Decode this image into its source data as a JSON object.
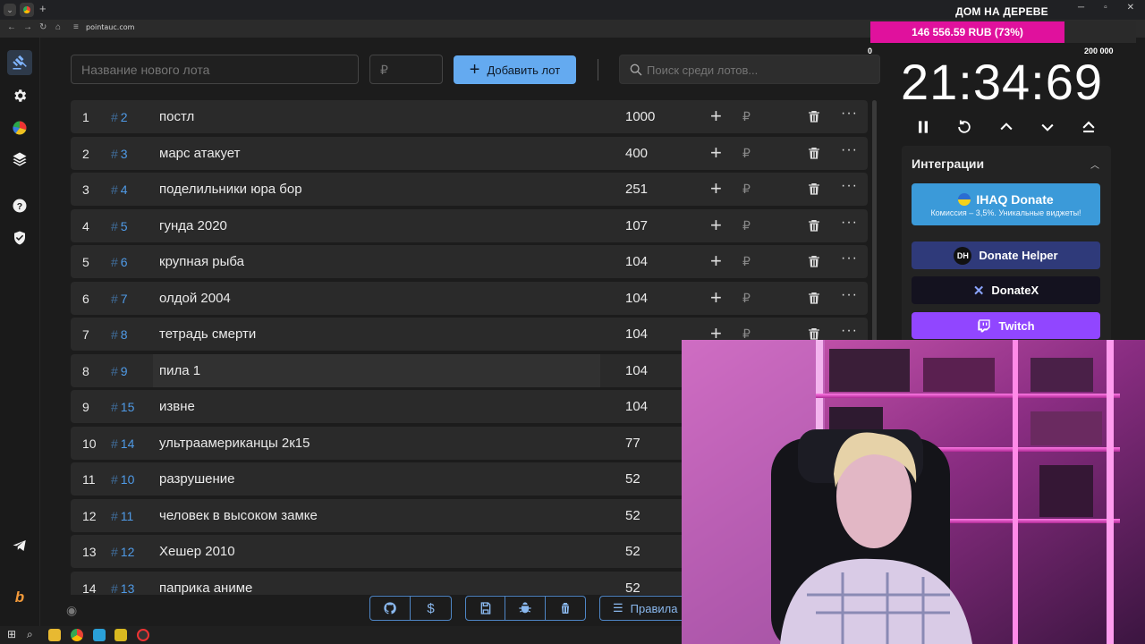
{
  "browser": {
    "url": "pointauc.com"
  },
  "stream": {
    "title": "ДОМ НА ДЕРЕВЕ",
    "goal_text": "146 556.59 RUB (73%)",
    "goal_progress": 0.73,
    "goal_min": "0",
    "goal_max": "200 000",
    "timer": "21:34:69"
  },
  "toolbar": {
    "lot_name_placeholder": "Название нового лота",
    "lot_price_placeholder": "₽",
    "add_label": "Добавить лот",
    "search_placeholder": "Поиск среди лотов..."
  },
  "lots": [
    {
      "idx": "1",
      "id": "2",
      "name": "постл",
      "amount": "1000"
    },
    {
      "idx": "2",
      "id": "3",
      "name": "марс атакует",
      "amount": "400"
    },
    {
      "idx": "3",
      "id": "4",
      "name": "поделильники юра бор",
      "amount": "251"
    },
    {
      "idx": "4",
      "id": "5",
      "name": "гунда 2020",
      "amount": "107"
    },
    {
      "idx": "5",
      "id": "6",
      "name": "крупная рыба",
      "amount": "104"
    },
    {
      "idx": "6",
      "id": "7",
      "name": "олдой 2004",
      "amount": "104"
    },
    {
      "idx": "7",
      "id": "8",
      "name": "тетрадь смерти",
      "amount": "104"
    },
    {
      "idx": "8",
      "id": "9",
      "name": "пила 1",
      "amount": "104"
    },
    {
      "idx": "9",
      "id": "15",
      "name": "извне",
      "amount": "104"
    },
    {
      "idx": "10",
      "id": "14",
      "name": "ультраамериканцы 2к15",
      "amount": "77"
    },
    {
      "idx": "11",
      "id": "10",
      "name": "разрушение",
      "amount": "52"
    },
    {
      "idx": "12",
      "id": "11",
      "name": "человек в высоком замке",
      "amount": "52"
    },
    {
      "idx": "13",
      "id": "12",
      "name": "Хешер 2010",
      "amount": "52"
    },
    {
      "idx": "14",
      "id": "13",
      "name": "паприка аниме",
      "amount": "52"
    }
  ],
  "lot_hash": "#",
  "lot_currency": "₽",
  "lot_more": "···",
  "footer": {
    "rules_label": "Правила"
  },
  "integrations": {
    "title": "Интеграции",
    "ihaq_title": "IHAQ Donate",
    "ihaq_subtitle": "Комиссия – 3,5%. Уникальные виджеты!",
    "donate_helper": "Donate Helper",
    "donate_helper_logo": "DH",
    "donatex": "DonateX",
    "twitch": "Twitch"
  },
  "colors": {
    "accent": "#64aaf0",
    "goal": "#e0119d",
    "twitch": "#9146ff"
  }
}
